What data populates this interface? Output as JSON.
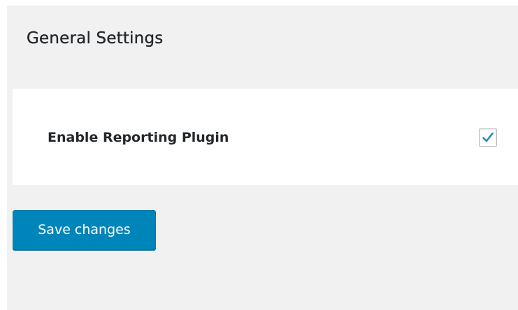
{
  "page": {
    "title": "General Settings"
  },
  "settings": [
    {
      "label": "Enable Reporting Plugin",
      "checked": true,
      "check_icon": "checkmark-icon"
    }
  ],
  "actions": {
    "save_label": "Save changes"
  },
  "colors": {
    "panel_background": "#f1f1f1",
    "card_background": "#ffffff",
    "text": "#23282d",
    "primary_button": "#0085ba",
    "checkmark": "#1e8cbe"
  }
}
